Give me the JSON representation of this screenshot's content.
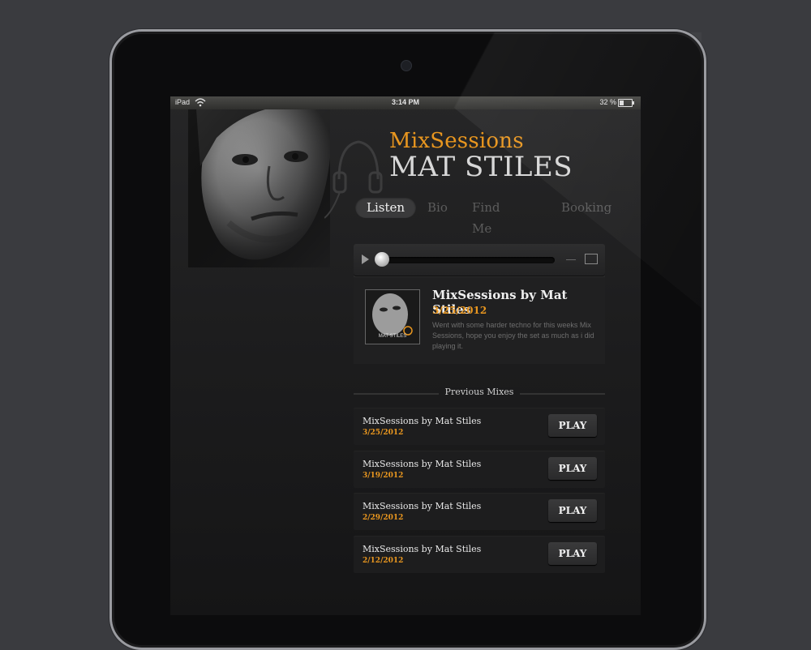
{
  "status_bar": {
    "carrier": "iPad",
    "time": "3:14 PM",
    "battery": "32 %"
  },
  "brand": {
    "series": "MixSessions",
    "artist": "MAT STILES"
  },
  "nav": {
    "items": [
      "Listen",
      "Bio",
      "Find Me On",
      "Booking"
    ],
    "active": "Listen"
  },
  "player": {
    "progress": 0.0
  },
  "current_mix": {
    "title": "MixSessions by Mat Stiles",
    "date": "3/25/2012",
    "description": "Went with some harder techno for this weeks Mix Sessions, hope you enjoy the set as much as i did playing it.",
    "cover_label": "MAT STILES"
  },
  "previous": {
    "header": "Previous Mixes",
    "play_label": "PLAY",
    "mixes": [
      {
        "title": "MixSessions by Mat Stiles",
        "date": "3/25/2012"
      },
      {
        "title": "MixSessions by Mat Stiles",
        "date": "3/19/2012"
      },
      {
        "title": "MixSessions by Mat Stiles",
        "date": "2/29/2012"
      },
      {
        "title": "MixSessions by Mat Stiles",
        "date": "2/12/2012"
      }
    ]
  },
  "colors": {
    "accent": "#e8961f",
    "background": "#3a3b3f",
    "screen": "#1d1d1e"
  }
}
